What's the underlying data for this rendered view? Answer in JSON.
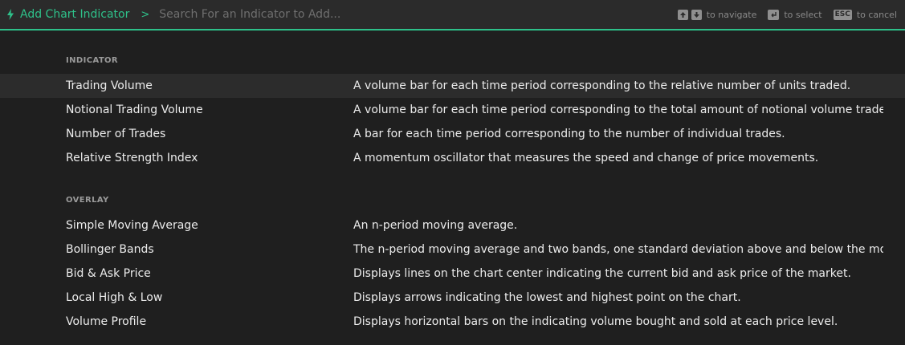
{
  "header": {
    "title": "Add Chart Indicator",
    "separator": ">",
    "search_placeholder": "Search For an Indicator to Add...",
    "hints": {
      "navigate": "to navigate",
      "select": "to select",
      "cancel_key": "ESC",
      "cancel": "to cancel"
    },
    "accent_color": "#2ec18a"
  },
  "sections": [
    {
      "title": "INDICATOR",
      "items": [
        {
          "name": "Trading Volume",
          "description": "A volume bar for each time period corresponding to the relative number of units traded.",
          "selected": true
        },
        {
          "name": "Notional Trading Volume",
          "description": "A volume bar for each time period corresponding to the total amount of notional volume traded."
        },
        {
          "name": "Number of Trades",
          "description": "A bar for each time period corresponding to the number of individual trades."
        },
        {
          "name": "Relative Strength Index",
          "description": "A momentum oscillator that measures the speed and change of price movements."
        }
      ]
    },
    {
      "title": "OVERLAY",
      "items": [
        {
          "name": "Simple Moving Average",
          "description": "An n-period moving average."
        },
        {
          "name": "Bollinger Bands",
          "description": "The n-period moving average and two bands, one standard deviation above and below the mov..."
        },
        {
          "name": "Bid & Ask Price",
          "description": "Displays lines on the chart center indicating the current bid and ask price of the market."
        },
        {
          "name": "Local High & Low",
          "description": "Displays arrows indicating the lowest and highest point on the chart."
        },
        {
          "name": "Volume Profile",
          "description": "Displays horizontal bars on the indicating volume bought and sold at each price level."
        }
      ]
    }
  ]
}
